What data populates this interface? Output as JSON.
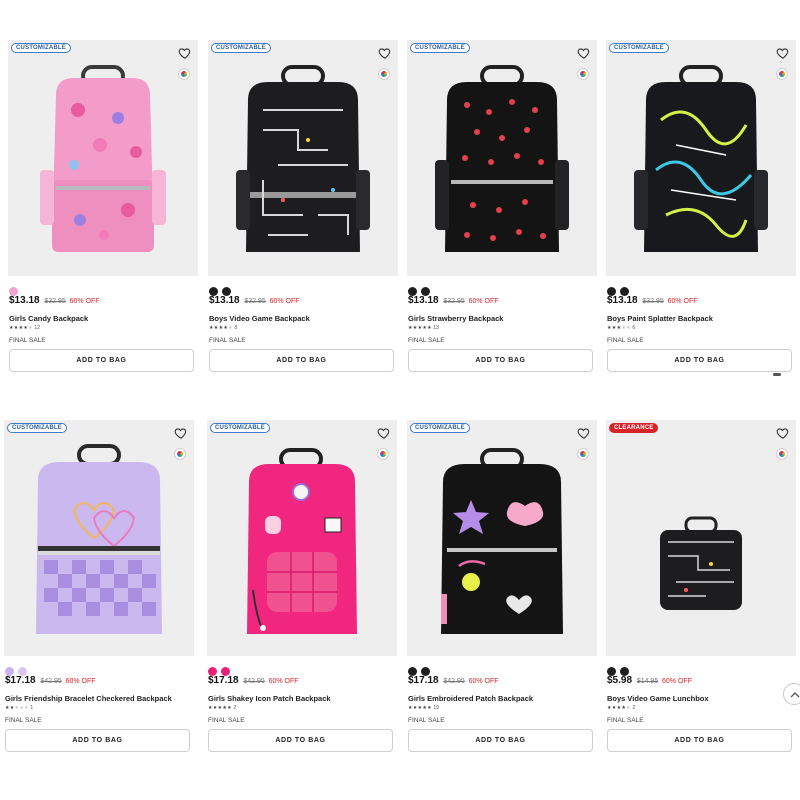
{
  "products": [
    {
      "badge": "CUSTOMIZABLE",
      "swatches": [
        "#f2a3cf"
      ],
      "price": "$13.18",
      "was": "$32.95",
      "off": "60% OFF",
      "name": "Girls Candy Backpack",
      "stars": 4,
      "reviews": "12",
      "final_sale": "FINAL SALE",
      "button": "ADD TO BAG",
      "icons": [
        "heart-icon",
        "color-wheel-icon"
      ]
    },
    {
      "badge": "CUSTOMIZABLE",
      "swatches": [
        "#1f1f1f",
        "#1f1f1f"
      ],
      "price": "$13.18",
      "was": "$32.95",
      "off": "60% OFF",
      "name": "Boys Video Game Backpack",
      "stars": 4,
      "reviews": "8",
      "final_sale": "FINAL SALE",
      "button": "ADD TO BAG",
      "icons": [
        "heart-icon",
        "color-wheel-icon"
      ]
    },
    {
      "badge": "CUSTOMIZABLE",
      "swatches": [
        "#1f1f1f",
        "#1f1f1f"
      ],
      "price": "$13.18",
      "was": "$32.95",
      "off": "60% OFF",
      "name": "Girls Strawberry Backpack",
      "stars": 5,
      "reviews": "13",
      "final_sale": "FINAL SALE",
      "button": "ADD TO BAG",
      "icons": [
        "heart-icon",
        "color-wheel-icon"
      ]
    },
    {
      "badge": "CUSTOMIZABLE",
      "swatches": [
        "#1f1f1f",
        "#1f1f1f"
      ],
      "price": "$13.18",
      "was": "$32.95",
      "off": "60% OFF",
      "name": "Boys Paint Splatter Backpack",
      "stars": 3,
      "reviews": "6",
      "final_sale": "FINAL SALE",
      "button": "ADD TO BAG",
      "icons": [
        "heart-icon",
        "color-wheel-icon"
      ]
    },
    {
      "badge": "CUSTOMIZABLE",
      "swatches": [
        "#c9b3ec",
        "#d8c7f2"
      ],
      "price": "$17.18",
      "was": "$42.95",
      "off": "60% OFF",
      "name": "Girls Friendship Bracelet Checkered Backpack",
      "stars": 2,
      "reviews": "1",
      "final_sale": "FINAL SALE",
      "button": "ADD TO BAG",
      "icons": [
        "heart-icon",
        "color-wheel-icon"
      ]
    },
    {
      "badge": "CUSTOMIZABLE",
      "swatches": [
        "#e8227a",
        "#e8227a"
      ],
      "price": "$17.18",
      "was": "$42.95",
      "off": "60% OFF",
      "name": "Girls Shakey Icon Patch Backpack",
      "stars": 5,
      "reviews": "2",
      "final_sale": "FINAL SALE",
      "button": "ADD TO BAG",
      "icons": [
        "heart-icon",
        "color-wheel-icon"
      ]
    },
    {
      "badge": "CUSTOMIZABLE",
      "swatches": [
        "#1f1f1f",
        "#1f1f1f"
      ],
      "price": "$17.18",
      "was": "$42.95",
      "off": "60% OFF",
      "name": "Girls Embroidered Patch Backpack",
      "stars": 5,
      "reviews": "19",
      "final_sale": "FINAL SALE",
      "button": "ADD TO BAG",
      "icons": [
        "heart-icon",
        "color-wheel-icon"
      ]
    },
    {
      "badge": "CLEARANCE",
      "swatches": [
        "#1f1f1f",
        "#1f1f1f"
      ],
      "price": "$5.98",
      "was": "$14.95",
      "off": "60% OFF",
      "name": "Boys Video Game Lunchbox",
      "stars": 4,
      "reviews": "2",
      "final_sale": "FINAL SALE",
      "button": "ADD TO BAG",
      "icons": [
        "heart-icon",
        "color-wheel-icon"
      ]
    }
  ],
  "colors": {
    "sale_red": "#d8232a",
    "badge_blue": "#3d7cc9",
    "image_bg": "#eeeeee"
  },
  "scroll_top": {
    "icon": "chevron-up-icon"
  }
}
